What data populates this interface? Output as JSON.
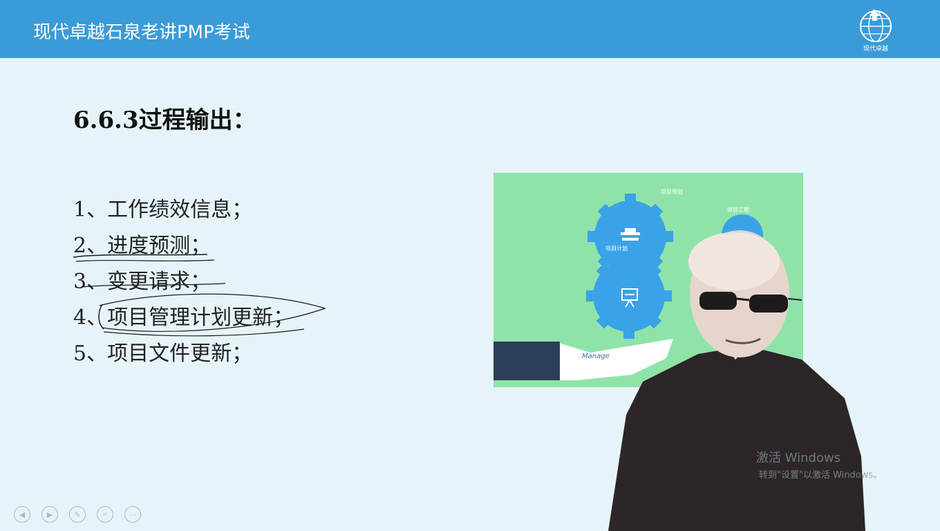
{
  "header": {
    "title": "现代卓越石泉老讲PMP考试",
    "logo_text": "现代卓越",
    "bg_color": "#3a9bd8"
  },
  "slide": {
    "title": "6.6.3过程输出：",
    "items": [
      "1、工作绩效信息；",
      "2、进度预测；",
      "3、变更请求；",
      "4、项目管理计划更新；",
      "5、项目文件更新；"
    ]
  },
  "image": {
    "gear_labels": [
      "项目规划",
      "项目工期",
      "项目计划"
    ],
    "hand_text": "Manage",
    "bg_color": "#8fe3a9",
    "gear_color": "#3aa3e8"
  },
  "watermark": {
    "title": "激活 Windows",
    "subtitle": "转到\"设置\"以激活 Windows。"
  },
  "toolbar": {
    "icons": [
      "prev-icon",
      "play-icon",
      "pen-icon",
      "zoom-icon",
      "more-icon"
    ]
  }
}
